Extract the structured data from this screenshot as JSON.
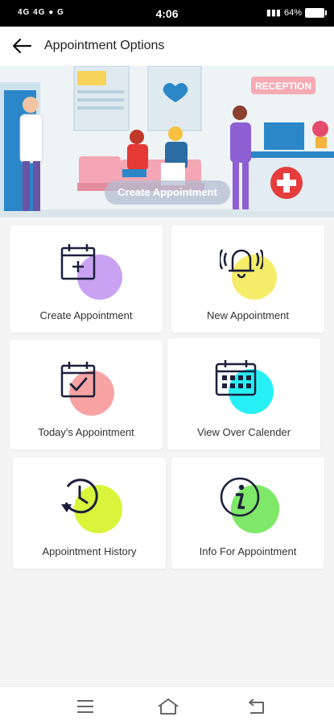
{
  "status": {
    "left": "4G 4G ● G",
    "time": "4:06",
    "battery": "64%"
  },
  "header": {
    "title": "Appointment Options"
  },
  "banner": {
    "sign": "RECEPTION",
    "button_label": "Create Appointment"
  },
  "cards": [
    {
      "label": "Create Appointment",
      "icon": "calendar-plus-icon",
      "blob_color": "#c9a2f3"
    },
    {
      "label": "New Appointment",
      "icon": "bell-icon",
      "blob_color": "#f5ec6a"
    },
    {
      "label": "Today's Appointment",
      "icon": "calendar-check-icon",
      "blob_color": "#f7a3a3"
    },
    {
      "label": "View Over Calender",
      "icon": "calendar-grid-icon",
      "blob_color": "#27f0f4"
    },
    {
      "label": "Appointment History",
      "icon": "history-icon",
      "blob_color": "#d9f53b"
    },
    {
      "label": "Info For Appointment",
      "icon": "info-icon",
      "blob_color": "#7fe868"
    }
  ],
  "navbar": {
    "items": [
      "menu",
      "home",
      "back"
    ]
  }
}
